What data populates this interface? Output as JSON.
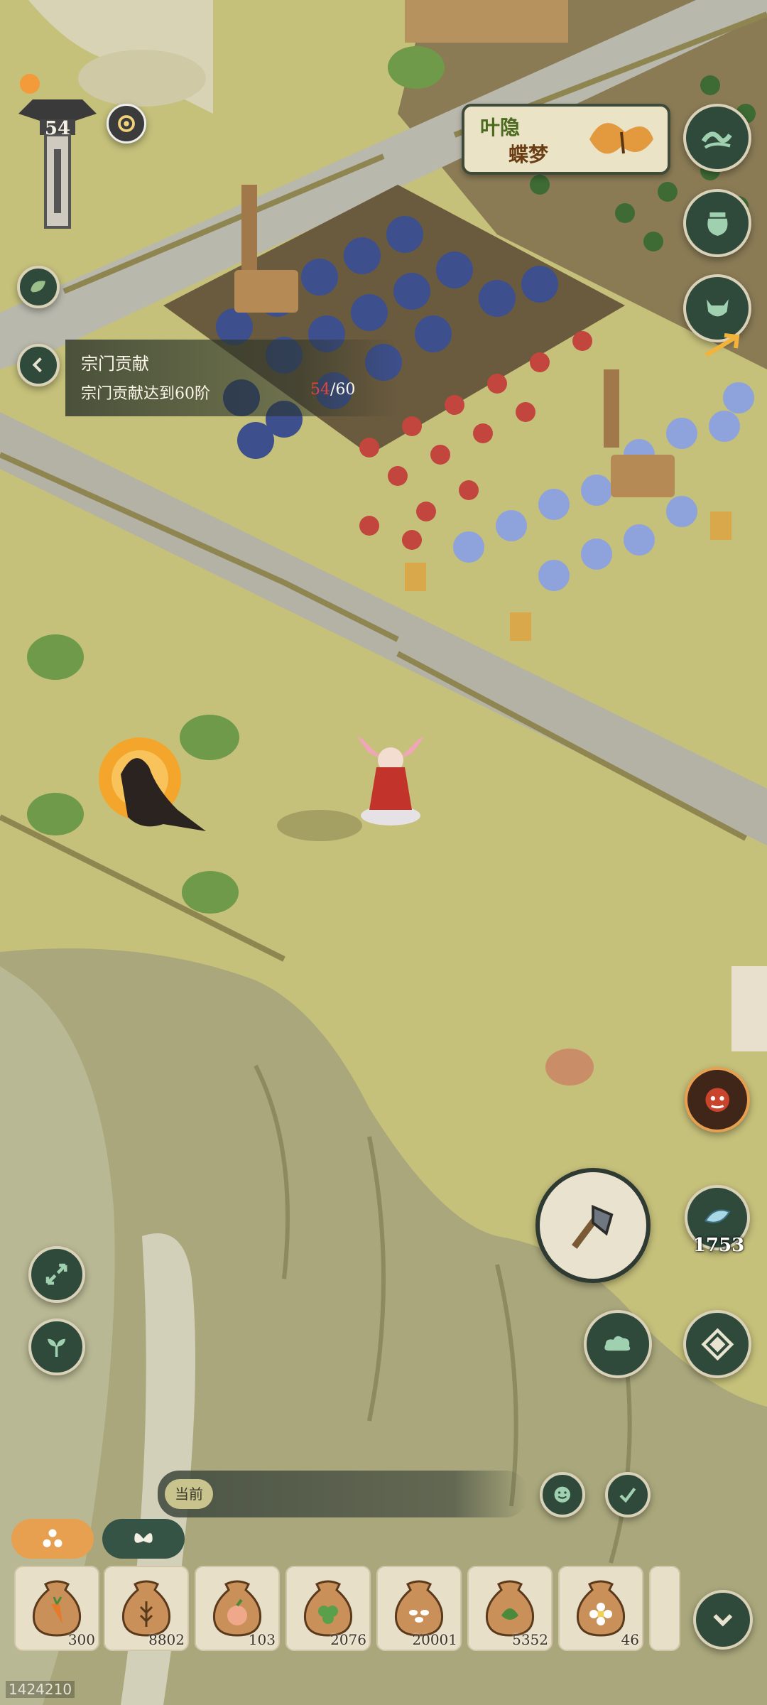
{
  "player": {
    "level": "54"
  },
  "task": {
    "title": "宗门贡献",
    "description": "宗门贡献达到60阶",
    "progress_current": "54",
    "progress_total": "/60"
  },
  "event_banner": {
    "line1": "叶隐",
    "line2": "蝶梦"
  },
  "currency": {
    "amount": "1753"
  },
  "chat": {
    "channel_label": "当前"
  },
  "inventory": {
    "items": [
      {
        "icon": "carrot-seed-bag-icon",
        "count": "300"
      },
      {
        "icon": "grain-seed-bag-icon",
        "count": "8802"
      },
      {
        "icon": "peach-seed-bag-icon",
        "count": "103"
      },
      {
        "icon": "clover-seed-bag-icon",
        "count": "2076"
      },
      {
        "icon": "rice-seed-bag-icon",
        "count": "20001"
      },
      {
        "icon": "herb-seed-bag-icon",
        "count": "5352"
      },
      {
        "icon": "flower-seed-bag-icon",
        "count": "46"
      }
    ]
  },
  "footer": {
    "id": "1424210"
  },
  "colors": {
    "panel_dark": "#2f4a3b",
    "accent_orange": "#e6a050",
    "progress_red": "#e0463c"
  }
}
